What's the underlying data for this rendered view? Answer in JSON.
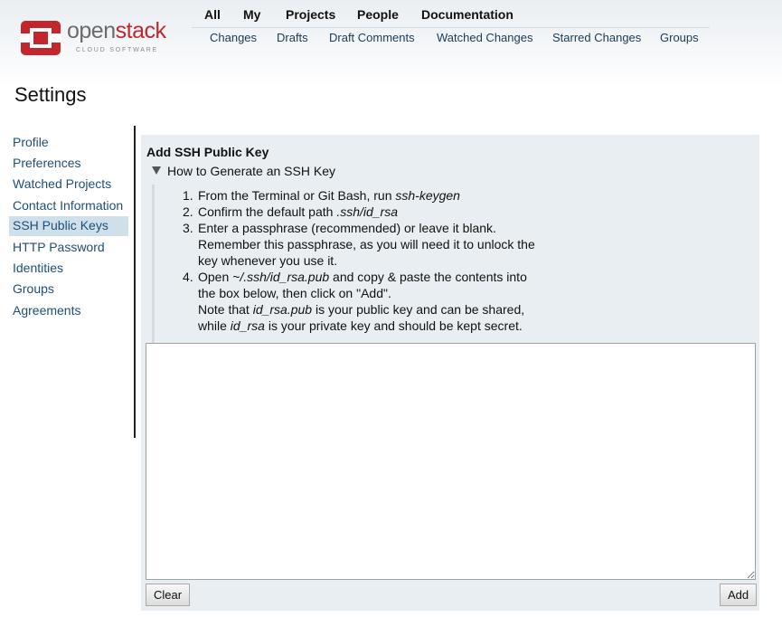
{
  "logo": {
    "word_open": "open",
    "word_stack": "stack",
    "tagline": "CLOUD SOFTWARE"
  },
  "topnav": [
    "All",
    "My",
    "Projects",
    "People",
    "Documentation"
  ],
  "subnav": [
    "Changes",
    "Drafts",
    "Draft Comments",
    "Watched Changes",
    "Starred Changes",
    "Groups"
  ],
  "page_title": "Settings",
  "sidebar": {
    "items": [
      "Profile",
      "Preferences",
      "Watched Projects",
      "Contact Information",
      "SSH Public Keys",
      "HTTP Password",
      "Identities",
      "Groups",
      "Agreements"
    ],
    "active": "SSH Public Keys"
  },
  "panel": {
    "title": "Add SSH Public Key",
    "howto_label": "How to Generate an SSH Key",
    "steps": {
      "n1": "1.",
      "s1_a": "From the Terminal or Git Bash, run ",
      "s1_b": "ssh-keygen",
      "n2": "2.",
      "s2_a": "Confirm the default path ",
      "s2_b": ".ssh/id_rsa",
      "n3": "3.",
      "s3_l1": "Enter a passphrase (recommended) or leave it blank.",
      "s3_l2": "Remember this passphrase, as you will need it to unlock the",
      "s3_l3": "key whenever you use it.",
      "n4": "4.",
      "s4_a": "Open ",
      "s4_b": "~/.ssh/id_rsa.pub",
      "s4_c": " and copy & paste the contents into",
      "s4_l2": "the box below, then click on \"Add\".",
      "s4_l3_a": "Note that ",
      "s4_l3_b": "id_rsa.pub",
      "s4_l3_c": " is your public key and can be shared,",
      "s4_l4_a": "while ",
      "s4_l4_b": "id_rsa",
      "s4_l4_c": " is your private key and should be kept secret."
    },
    "textarea_value": "",
    "clear_label": "Clear",
    "add_label": "Add"
  },
  "colors": {
    "brand_red": "#c1272d",
    "active_bg": "#cfe0ea",
    "panel_bg": "#e8eef1",
    "link": "#1f4e79"
  },
  "icons": {
    "logo": "openstack-logo-icon",
    "toggle": "triangle-down-icon"
  }
}
